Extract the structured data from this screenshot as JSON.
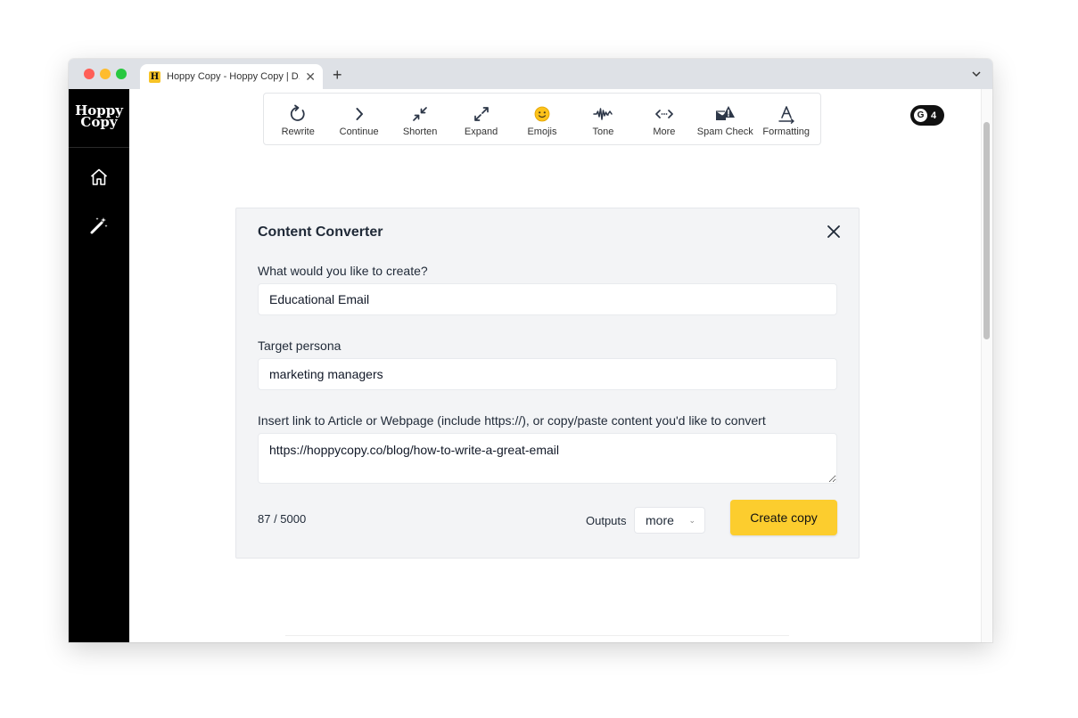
{
  "browser": {
    "tab_title": "Hoppy Copy - Hoppy Copy | D...",
    "favicon_letter": "H",
    "new_tab_label": "+"
  },
  "sidebar": {
    "logo_line1": "Hoppy",
    "logo_line2": "Copy",
    "items": [
      {
        "icon": "home-icon"
      },
      {
        "icon": "magic-wand-icon"
      }
    ]
  },
  "toolbar": {
    "items": [
      {
        "label": "Rewrite",
        "icon": "rewrite-icon"
      },
      {
        "label": "Continue",
        "icon": "chevron-right-icon"
      },
      {
        "label": "Shorten",
        "icon": "shorten-icon"
      },
      {
        "label": "Expand",
        "icon": "expand-icon"
      },
      {
        "label": "Emojis",
        "icon": "emoji-icon"
      },
      {
        "label": "Tone",
        "icon": "tone-wave-icon"
      },
      {
        "label": "More",
        "icon": "more-icon"
      },
      {
        "label": "Spam Check",
        "icon": "spam-check-icon"
      },
      {
        "label": "Formatting",
        "icon": "formatting-icon"
      }
    ]
  },
  "grammarly": {
    "count": "4"
  },
  "converter": {
    "title": "Content Converter",
    "q1_label": "What would you like to create?",
    "q1_value": "Educational Email",
    "q2_label": "Target persona",
    "q2_value": "marketing managers",
    "q3_label": "Insert link to Article or Webpage (include https://), or copy/paste content you'd like to convert",
    "q3_value": "https://hoppycopy.co/blog/how-to-write-a-great-email",
    "counter": "87 / 5000",
    "outputs_label": "Outputs",
    "outputs_value": "more",
    "create_button": "Create copy"
  },
  "colors": {
    "accent": "#fccd2e",
    "sidebar": "#000000",
    "card_bg": "#f3f4f6"
  }
}
